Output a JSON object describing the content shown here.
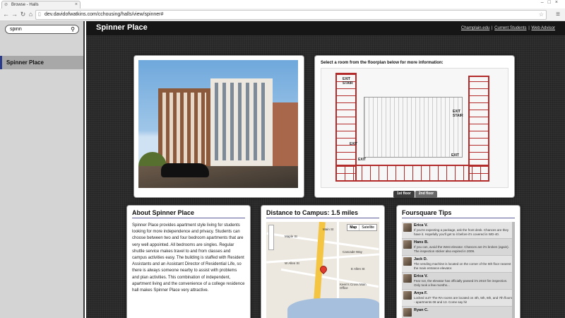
{
  "browser": {
    "tab_title": "Browse - Halls",
    "url": "dev.davidofwatkins.com/cchousing/halls/view/spinner#"
  },
  "sidebar": {
    "search_value": "spinn",
    "items": [
      {
        "label": "Spinner Place"
      }
    ]
  },
  "header": {
    "title": "Spinner Place",
    "links": [
      "Champlain.edu",
      "Current Students",
      "Web Advisor"
    ],
    "separator": "|"
  },
  "floorplan": {
    "caption": "Select a room from the floorplan below for more information:",
    "labels": [
      "EXIT STAIR",
      "EXIT STAIR",
      "EXIT",
      "EXIT",
      "EXIT"
    ],
    "buttons": [
      "1st floor",
      "2nd floor"
    ]
  },
  "about": {
    "title": "About Spinner Place",
    "text": "Spinner Place provides apartment style living for students looking for more independence and privacy. Students can choose between two and four bedroom apartments that are very well appointed. All bedrooms are singles. Regular shuttle service makes travel to and from classes and campus activities easy. The building is staffed with Resident Assistants and an Assistant Director of Residential Life, so there is always someone nearby to assist with problems and plan activities. This combination of independent, apartment living and the convenience of a college residence hall makes Spinner Place very attractive."
  },
  "distance": {
    "title": "Distance to Campus: 1.5 miles",
    "map_types": [
      "Map",
      "Satellite"
    ],
    "map_labels": [
      "Maple St",
      "Main St",
      "Cascade Way",
      "W Allen St",
      "E Allen St",
      "Keen's Cross Main Office"
    ]
  },
  "tips": {
    "title": "Foursquare Tips",
    "items": [
      {
        "name": "Erica V.",
        "text": "If you're expecting a package, ask the front desk. Chances are they have it. Hopefully you'll get to it before it's covered in WD-40."
      },
      {
        "name": "Hans B.",
        "text": "If you can, avoid the West elevator. Chances are it's broken (again). The inspection sticker also expired in 2009."
      },
      {
        "name": "Jack D.",
        "text": "The vending machine is located on the corner of the 5th floor nearest the main entrance elevator."
      },
      {
        "name": "Erica V.",
        "text": "Fear not, the elevator has officially passed it's 2010 fire inspection. Only took a few months..."
      },
      {
        "name": "Anya F.",
        "text": "Locked out? The RA rooms are located on 4th, 5th, 6th, and 7th floors - apartments 08 and 13. Come say hi!"
      },
      {
        "name": "Ryan C.",
        "text": ""
      }
    ]
  }
}
